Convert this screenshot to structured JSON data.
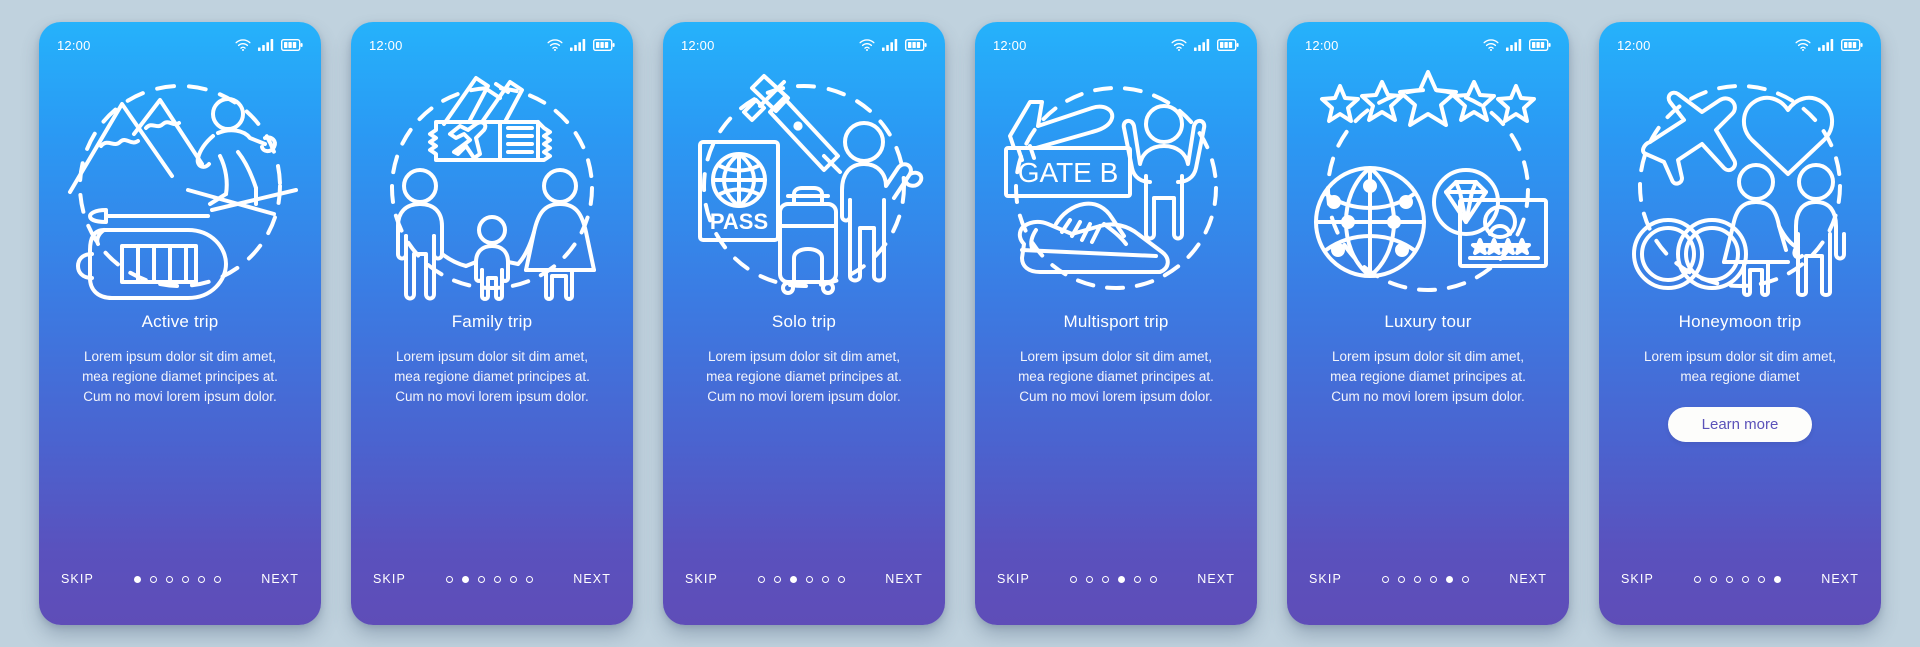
{
  "background_color": "#c0d2de",
  "accent_top": "#25b2fb",
  "accent_bottom": "#5f4db8",
  "statusbar": {
    "time": "12:00",
    "icons": [
      "wifi-icon",
      "cellular-signal-icon",
      "battery-icon"
    ]
  },
  "common": {
    "skip_label": "SKIP",
    "next_label": "NEXT",
    "dot_count": 6
  },
  "screens": [
    {
      "id": "active-trip",
      "title": "Active trip",
      "description": "Lorem ipsum dolor sit dim amet, mea regione diamet principes at. Cum no movi lorem ipsum dolor.",
      "active_dot": 1,
      "icons": [
        "mountains-icon",
        "skier-icon",
        "inflatable-raft-icon",
        "paddle-icon",
        "dashed-circle-icon"
      ],
      "cta": null
    },
    {
      "id": "family-trip",
      "title": "Family trip",
      "description": "Lorem ipsum dolor sit dim amet, mea regione diamet principes at. Cum no movi lorem ipsum dolor.",
      "active_dot": 2,
      "icons": [
        "airplane-tickets-icon",
        "family-group-icon",
        "dashed-circle-icon"
      ],
      "cta": null
    },
    {
      "id": "solo-trip",
      "title": "Solo trip",
      "description": "Lorem ipsum dolor sit dim amet, mea regione diamet principes at. Cum no movi lorem ipsum dolor.",
      "active_dot": 3,
      "icons": [
        "passport-icon",
        "selfie-stick-icon",
        "suitcase-icon",
        "waving-person-icon",
        "dashed-circle-icon"
      ],
      "passport_label": "PASS",
      "cta": null
    },
    {
      "id": "multisport-trip",
      "title": "Multisport trip",
      "description": "Lorem ipsum dolor sit dim amet, mea regione diamet principes at. Cum no movi lorem ipsum dolor.",
      "active_dot": 4,
      "icons": [
        "airplane-icon",
        "gate-sign-icon",
        "sneakers-icon",
        "cheering-person-icon",
        "dashed-circle-icon"
      ],
      "gate_label": "GATE B",
      "cta": null
    },
    {
      "id": "luxury-tour",
      "title": "Luxury tour",
      "description": "Lorem ipsum dolor sit dim amet, mea regione diamet principes at. Cum no movi lorem ipsum dolor.",
      "active_dot": 5,
      "icons": [
        "five-stars-icon",
        "globe-network-icon",
        "diamond-icon",
        "vip-card-icon",
        "dashed-circle-icon"
      ],
      "cta": null
    },
    {
      "id": "honeymoon-trip",
      "title": "Honeymoon trip",
      "description": "Lorem ipsum dolor sit dim amet, mea regione diamet",
      "active_dot": 6,
      "icons": [
        "airplane-icon",
        "heart-icon",
        "wedding-rings-icon",
        "couple-icon",
        "dashed-circle-icon"
      ],
      "cta": "Learn more"
    }
  ]
}
